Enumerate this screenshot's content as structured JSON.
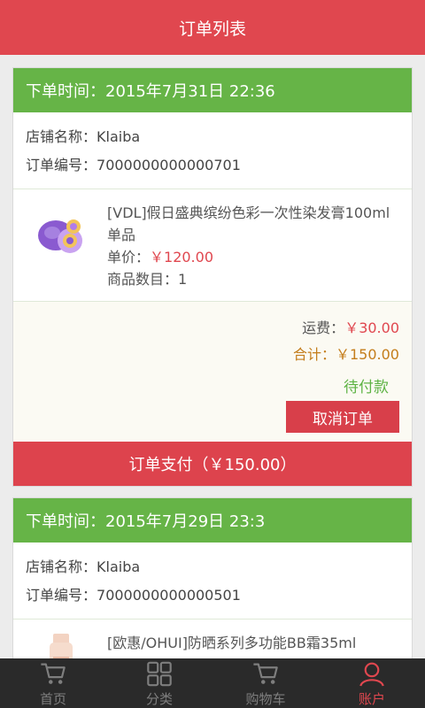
{
  "header": {
    "title": "订单列表"
  },
  "orders": [
    {
      "time_label": "下单时间：",
      "time": "2015年7月31日 22:36",
      "shop_label": "店铺名称：",
      "shop": "Klaiba",
      "no_label": "订单编号：",
      "no": "7000000000000701",
      "product": {
        "name": "[VDL]假日盛典缤纷色彩一次性染发膏100ml 单品",
        "price_label": "单价：",
        "price": "￥120.00",
        "qty_label": "商品数目：",
        "qty": "1"
      },
      "freight_label": "运费：",
      "freight": "￥30.00",
      "total_label": "合计：",
      "total": "￥150.00",
      "status": "待付款",
      "cancel_label": "取消订单",
      "pay_label": "订单支付（￥150.00）"
    },
    {
      "time_label": "下单时间：",
      "time": "2015年7月29日 23:3",
      "shop_label": "店铺名称：",
      "shop": "Klaiba",
      "no_label": "订单编号：",
      "no": "7000000000000501",
      "product": {
        "name": "[欧惠/OHUI]防晒系列多功能BB霜35ml"
      }
    }
  ],
  "tabs": [
    {
      "label": "首页",
      "icon": "cart-icon"
    },
    {
      "label": "分类",
      "icon": "grid-icon"
    },
    {
      "label": "购物车",
      "icon": "cart-icon"
    },
    {
      "label": "账户",
      "icon": "user-icon"
    }
  ],
  "colors": {
    "header": "#e0474f",
    "card_head": "#66b447",
    "status": "#5db344",
    "active_tab": "#e0474f"
  }
}
